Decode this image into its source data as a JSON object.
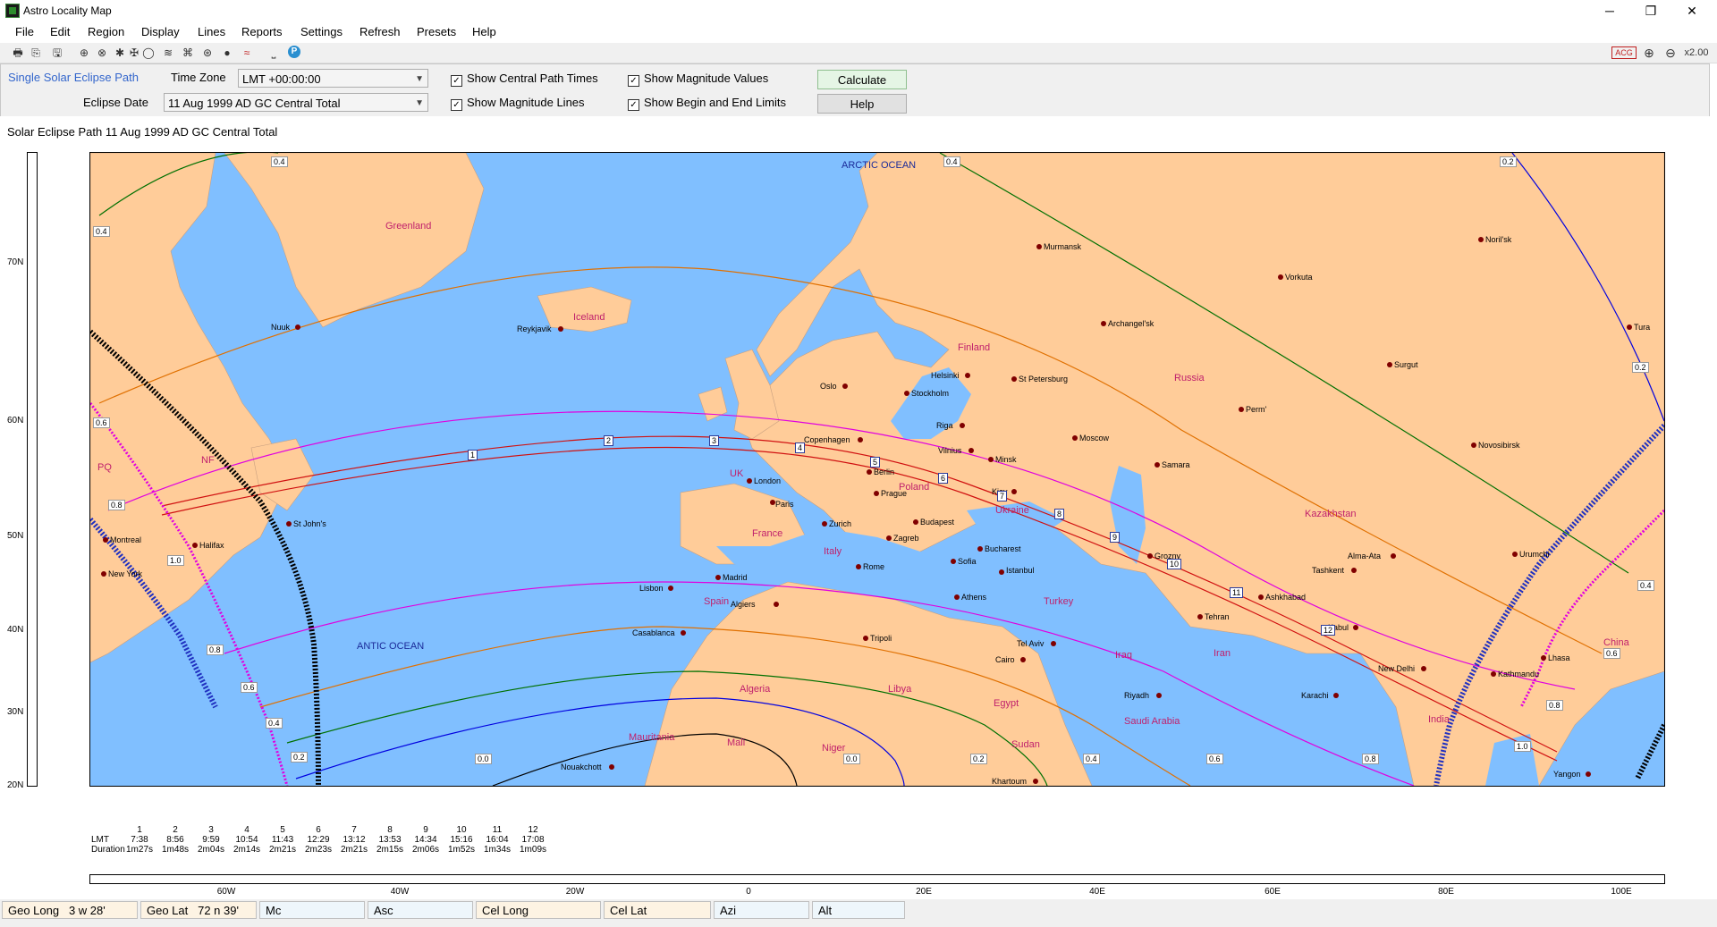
{
  "app": {
    "title": "Astro Locality Map",
    "controls": {
      "minimize": "─",
      "maximize": "❐",
      "close": "✕"
    }
  },
  "menu": [
    "File",
    "Edit",
    "Region",
    "Display",
    "Lines",
    "Reports",
    "Settings",
    "Refresh",
    "Presets",
    "Help"
  ],
  "toolbar": {
    "icons": [
      "printer-icon",
      "copy-icon",
      "save-icon",
      "globe-icon",
      "globe-net-icon",
      "planets-icon",
      "chart-icon",
      "circle-icon",
      "transit-icon",
      "progression-icon",
      "geo-sig-icon",
      "eclipse-icon",
      "waves-icon",
      "minimize-panel-icon",
      "parking-icon"
    ],
    "glyphs": [
      "🖶",
      "⎘",
      "🖫",
      "⊕",
      "⊗",
      "✱",
      "✠",
      "◯",
      "≋",
      "⌘",
      "⊛",
      "●",
      "≈",
      "⎵",
      "P"
    ],
    "acg_label": "ACG",
    "zoom_level": "x2.00"
  },
  "panel": {
    "mode": "Single Solar Eclipse Path",
    "timezone_label": "Time Zone",
    "timezone_value": "LMT +00:00:00",
    "eclipse_date_label": "Eclipse Date",
    "eclipse_date_value": "11 Aug 1999 AD GC Central Total",
    "show_central_times": "Show Central Path Times",
    "show_mag_lines": "Show Magnitude Lines",
    "show_mag_values": "Show Magnitude Values",
    "show_limits": "Show Begin and End Limits",
    "checked": true,
    "calculate": "Calculate",
    "help": "Help"
  },
  "map": {
    "caption": "Solar Eclipse Path 11 Aug 1999 AD GC Central Total",
    "lat_ticks": [
      "70N",
      "60N",
      "50N",
      "40N",
      "30N",
      "20N"
    ],
    "lon_ticks": [
      "60W",
      "40W",
      "20W",
      "0",
      "20E",
      "40E",
      "60E",
      "80E",
      "100E"
    ],
    "ocean_labels": [
      "ARCTIC OCEAN",
      "ANTIC OCEAN"
    ],
    "country_labels": [
      "Greenland",
      "Iceland",
      "Finland",
      "Russia",
      "UK",
      "Poland",
      "Ukraine",
      "France",
      "Italy",
      "Spain",
      "Kazakhstan",
      "Turkey",
      "Iraq",
      "Iran",
      "Algeria",
      "Libya",
      "Egypt",
      "Saudi Arabia",
      "Mauritania",
      "Mali",
      "Niger",
      "Sudan",
      "India",
      "China",
      "PQ",
      "NF"
    ],
    "cities": [
      "Murmansk",
      "Vorkuta",
      "Noril'sk",
      "Nuuk",
      "Reykjavik",
      "Archangel'sk",
      "Tura",
      "Surgut",
      "Oslo",
      "Helsinki",
      "Stockholm",
      "St Petersburg",
      "Perm'",
      "Riga",
      "Copenhagen",
      "Moscow",
      "Vilnius",
      "Minsk",
      "Novosibirsk",
      "London",
      "Berlin",
      "Samara",
      "Prague",
      "Kiev",
      "Paris",
      "Zurich",
      "Budapest",
      "St John's",
      "Montreal",
      "Halifax",
      "Zagreb",
      "Bucharest",
      "Grozny",
      "Urumchi",
      "Alma-Ata",
      "Sofia",
      "Tashkent",
      "New York",
      "Madrid",
      "Rome",
      "Istanbul",
      "Lisbon",
      "Athens",
      "Ashkhabad",
      "Algiers",
      "Tehran",
      "Kabul",
      "Casablanca",
      "Tripoli",
      "Tel Aviv",
      "Cairo",
      "Lhasa",
      "New Delhi",
      "Kathmandu",
      "Riyadh",
      "Karachi",
      "Nouakchott",
      "Khartoum",
      "Yangon"
    ],
    "mag_values": [
      "0.4",
      "0.4",
      "0.4",
      "0.2",
      "0.2",
      "0.6",
      "0.8",
      "1.0",
      "0.8",
      "0.6",
      "0.4",
      "0.2",
      "0.0",
      "0.0",
      "0.2",
      "0.4",
      "0.6",
      "0.8",
      "1.0",
      "0.8",
      "0.6",
      "0.4"
    ],
    "time_markers": [
      "1",
      "2",
      "3",
      "4",
      "5",
      "6",
      "7",
      "8",
      "9",
      "10",
      "11",
      "12"
    ]
  },
  "times": {
    "row_label_lmt": "LMT",
    "row_label_duration": "Duration",
    "columns": [
      {
        "n": "1",
        "lmt": "7:38",
        "dur": "1m27s"
      },
      {
        "n": "2",
        "lmt": "8:56",
        "dur": "1m48s"
      },
      {
        "n": "3",
        "lmt": "9:59",
        "dur": "2m04s"
      },
      {
        "n": "4",
        "lmt": "10:54",
        "dur": "2m14s"
      },
      {
        "n": "5",
        "lmt": "11:43",
        "dur": "2m21s"
      },
      {
        "n": "6",
        "lmt": "12:29",
        "dur": "2m23s"
      },
      {
        "n": "7",
        "lmt": "13:12",
        "dur": "2m21s"
      },
      {
        "n": "8",
        "lmt": "13:53",
        "dur": "2m15s"
      },
      {
        "n": "9",
        "lmt": "14:34",
        "dur": "2m06s"
      },
      {
        "n": "10",
        "lmt": "15:16",
        "dur": "1m52s"
      },
      {
        "n": "11",
        "lmt": "16:04",
        "dur": "1m34s"
      },
      {
        "n": "12",
        "lmt": "17:08",
        "dur": "1m09s"
      }
    ]
  },
  "status": {
    "geo_long_label": "Geo Long",
    "geo_long_value": "3 w 28'",
    "geo_lat_label": "Geo Lat",
    "geo_lat_value": "72 n 39'",
    "mc": "Mc",
    "asc": "Asc",
    "cel_long": "Cel Long",
    "cel_lat": "Cel Lat",
    "azi": "Azi",
    "alt": "Alt"
  },
  "colors": {
    "sea": "#80bfff",
    "land": "#ffcc99",
    "central": "#d01010",
    "mag_02": "#0000e0",
    "mag_04": "#007000",
    "mag_06": "#e07000",
    "mag_08": "#e000e0",
    "limit_begin": "#000000",
    "limit_end": "#2030c0"
  }
}
